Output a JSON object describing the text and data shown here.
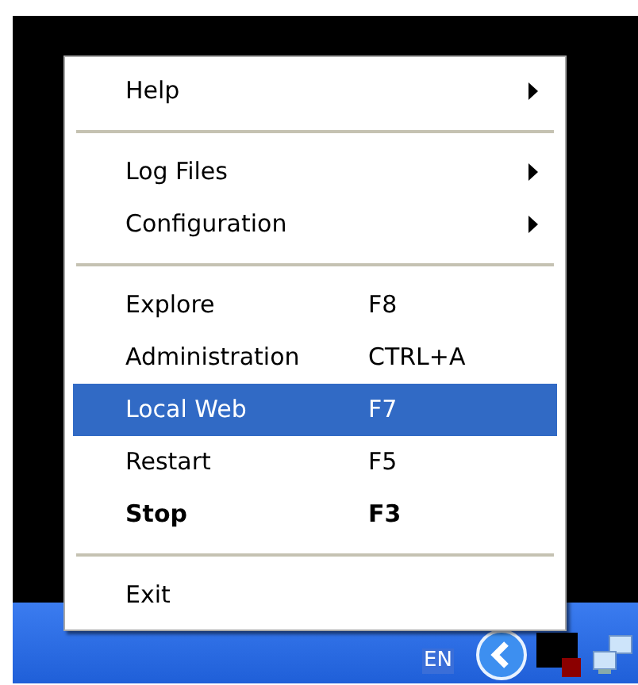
{
  "menu": {
    "groups": [
      {
        "items": [
          {
            "label": "Help",
            "submenu": true,
            "selected": false,
            "default": false
          }
        ]
      },
      {
        "items": [
          {
            "label": "Log Files",
            "submenu": true,
            "selected": false,
            "default": false
          },
          {
            "label": "Configuration",
            "submenu": true,
            "selected": false,
            "default": false
          }
        ]
      },
      {
        "items": [
          {
            "label": "Explore",
            "shortcut": "F8",
            "submenu": false,
            "selected": false,
            "default": false
          },
          {
            "label": "Administration",
            "shortcut": "CTRL+A",
            "submenu": false,
            "selected": false,
            "default": false
          },
          {
            "label": "Local Web",
            "shortcut": "F7",
            "submenu": false,
            "selected": true,
            "default": false
          },
          {
            "label": "Restart",
            "shortcut": "F5",
            "submenu": false,
            "selected": false,
            "default": false
          },
          {
            "label": "Stop",
            "shortcut": "F3",
            "submenu": false,
            "selected": false,
            "default": true
          }
        ]
      },
      {
        "items": [
          {
            "label": "Exit",
            "submenu": false,
            "selected": false,
            "default": false
          }
        ]
      }
    ]
  },
  "taskbar": {
    "language": "EN"
  }
}
